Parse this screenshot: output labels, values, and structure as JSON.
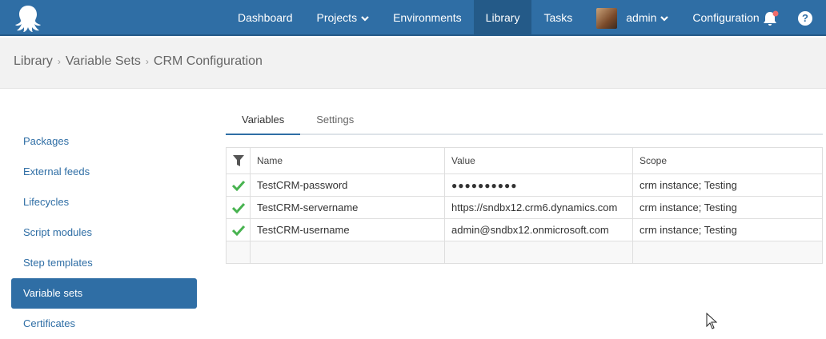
{
  "nav": {
    "items": [
      {
        "label": "Dashboard"
      },
      {
        "label": "Projects"
      },
      {
        "label": "Environments"
      },
      {
        "label": "Library"
      },
      {
        "label": "Tasks"
      },
      {
        "label": "admin"
      },
      {
        "label": "Configuration"
      }
    ],
    "help_label": "?"
  },
  "breadcrumb": [
    "Library",
    "Variable Sets",
    "CRM Configuration"
  ],
  "sidebar": {
    "items": [
      {
        "label": "Packages"
      },
      {
        "label": "External feeds"
      },
      {
        "label": "Lifecycles"
      },
      {
        "label": "Script modules"
      },
      {
        "label": "Step templates"
      },
      {
        "label": "Variable sets"
      },
      {
        "label": "Certificates"
      }
    ]
  },
  "tabs": [
    {
      "label": "Variables"
    },
    {
      "label": "Settings"
    }
  ],
  "table": {
    "headers": {
      "name": "Name",
      "value": "Value",
      "scope": "Scope"
    },
    "rows": [
      {
        "name": "TestCRM-password",
        "value": "●●●●●●●●●●",
        "scope": "crm instance; Testing"
      },
      {
        "name": "TestCRM-servername",
        "value": "https://sndbx12.crm6.dynamics.com",
        "scope": "crm instance; Testing"
      },
      {
        "name": "TestCRM-username",
        "value": "admin@sndbx12.onmicrosoft.com",
        "scope": "crm instance; Testing"
      }
    ]
  },
  "colors": {
    "topbar": "#2f6ea5",
    "active": "#245a88",
    "link": "#2f6ea5",
    "check": "#48b350",
    "notification_dot": "#f06c6c"
  },
  "icons": {
    "logo": "octopus-logo-icon",
    "filter": "filter-icon",
    "check": "check-icon",
    "bell": "bell-icon",
    "help": "help-icon",
    "chevron": "chevron-down-icon"
  }
}
